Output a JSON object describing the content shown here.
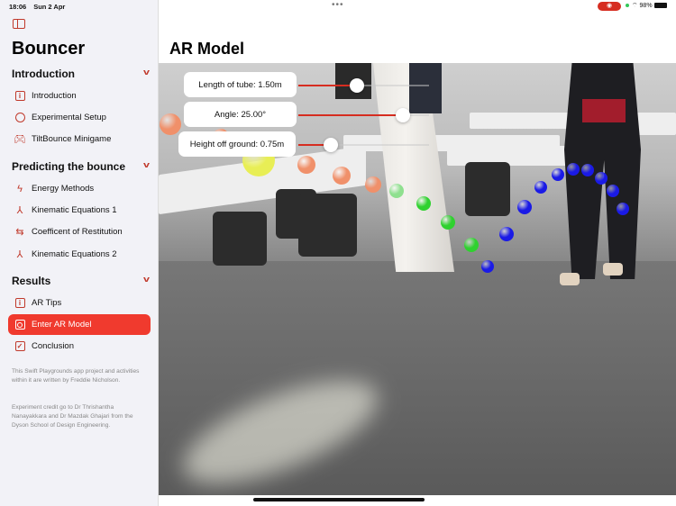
{
  "status_bar": {
    "time": "18:06",
    "date": "Sun 2 Apr",
    "battery": "98%",
    "more": "•••"
  },
  "sidebar": {
    "title": "Bouncer",
    "sections": [
      {
        "label": "Introduction",
        "items": [
          {
            "label": "Introduction",
            "icon": "info-square-icon"
          },
          {
            "label": "Experimental Setup",
            "icon": "circle-icon"
          },
          {
            "label": "TiltBounce Minigame",
            "icon": "gamecontroller-icon"
          }
        ]
      },
      {
        "label": "Predicting the bounce",
        "items": [
          {
            "label": "Energy Methods",
            "icon": "bolt-icon"
          },
          {
            "label": "Kinematic Equations 1",
            "icon": "axes-icon"
          },
          {
            "label": "Coefficent of Restitution",
            "icon": "arrows-bounce-icon"
          },
          {
            "label": "Kinematic Equations 2",
            "icon": "axes-icon"
          }
        ]
      },
      {
        "label": "Results",
        "items": [
          {
            "label": "AR Tips",
            "icon": "info-square-icon"
          },
          {
            "label": "Enter AR Model",
            "icon": "ar-icon",
            "selected": true
          },
          {
            "label": "Conclusion",
            "icon": "checkbox-icon"
          }
        ]
      }
    ],
    "notes": [
      "This Swift Playgrounds app project and activities within it are written by Freddie Nicholson.",
      "Experiment credit go to Dr Thrishantha Nanayakkara and Dr Mazdak Ghajari from the Dyson School of Design Engineering."
    ]
  },
  "main": {
    "title": "AR Model",
    "controls": [
      {
        "label": "Length of tube: 1.50m",
        "fraction": 0.45
      },
      {
        "label": "Angle: 25.00°",
        "fraction": 0.8
      },
      {
        "label": "Height off ground: 0.75m",
        "fraction": 0.25
      }
    ]
  },
  "colors": {
    "accent": "#f03a2e",
    "slider": "#d62d20",
    "ball_orange": "#f0906a",
    "ball_green": "#2fd12f",
    "ball_blue": "#1a1ae6"
  }
}
